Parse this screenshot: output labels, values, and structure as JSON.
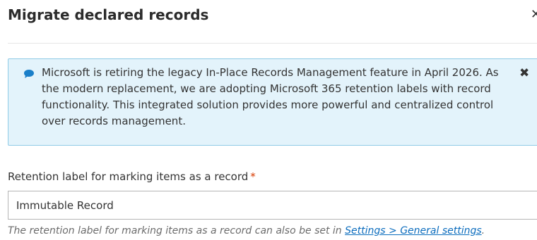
{
  "dialog": {
    "title": "Migrate declared records",
    "close_glyph": "✕",
    "close_icon": "close-icon"
  },
  "notice": {
    "icon": "speech-bubble-icon",
    "text": "Microsoft is retiring the legacy In-Place Records Management feature in April 2026. As the modern replacement, we are adopting Microsoft 365 retention labels with record functionality. This integrated solution provides more powerful and centralized control over records management.",
    "close_glyph": "✖",
    "colors": {
      "background": "#e3f3fb",
      "border": "#8fcbe6",
      "icon": "#1a7fc9"
    }
  },
  "retention_field": {
    "label": "Retention label for marking items as a record",
    "required_marker": "*",
    "value": "Immutable Record",
    "help_prefix": "The retention label for marking items as a record can also be set in ",
    "help_link": "Settings > General settings",
    "help_suffix": "."
  }
}
